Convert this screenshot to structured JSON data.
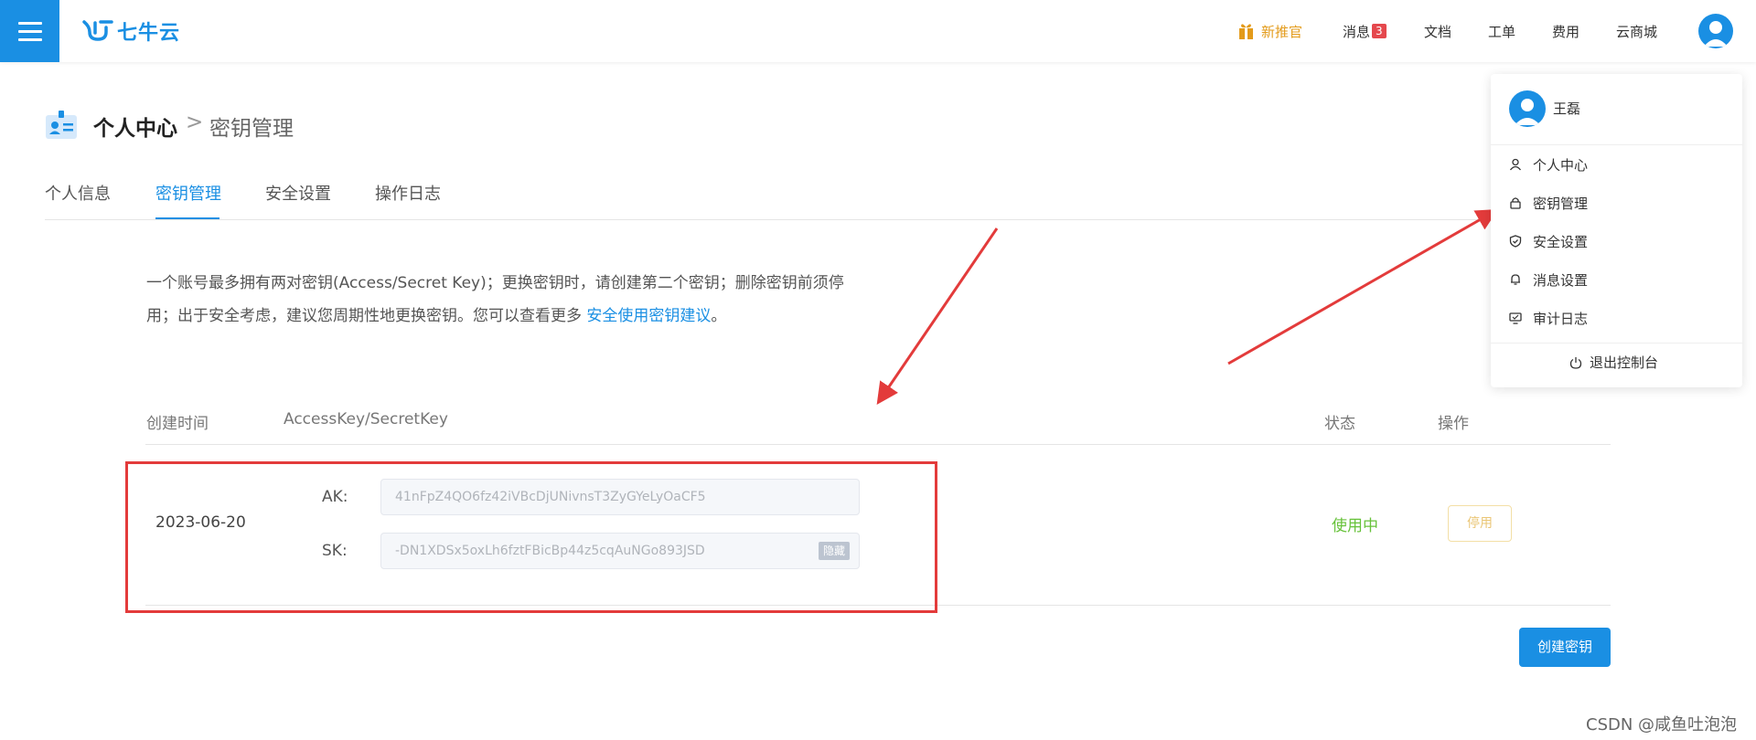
{
  "header": {
    "logo_text": "七牛云",
    "nav": {
      "new_promo": "新推官",
      "messages": "消息",
      "messages_count": "3",
      "docs": "文档",
      "tickets": "工单",
      "billing": "费用",
      "marketplace": "云商城"
    }
  },
  "page": {
    "title": "个人中心",
    "separator": ">",
    "subtitle": "密钥管理"
  },
  "tabs": [
    {
      "label": "个人信息"
    },
    {
      "label": "密钥管理"
    },
    {
      "label": "安全设置"
    },
    {
      "label": "操作日志"
    }
  ],
  "description": {
    "line1": "一个账号最多拥有两对密钥(Access/Secret Key)；更换密钥时，请创建第二个密钥；删除密钥前须停",
    "line2": "用；出于安全考虑，建议您周期性地更换密钥。您可以查看更多 ",
    "link": "安全使用密钥建议",
    "line2_end": "。"
  },
  "table": {
    "headers": {
      "created": "创建时间",
      "keys": "AccessKey/SecretKey",
      "status": "状态",
      "action": "操作"
    },
    "rows": [
      {
        "created": "2023-06-20",
        "ak_label": "AK:",
        "ak_value": "41nFpZ4QO6fz42iVBcDjUNivnsT3ZyGYeLyOaCF5",
        "sk_label": "SK:",
        "sk_value": "-DN1XDSx5oxLh6fztFBicBp44z5cqAuNGo893JSD",
        "hide_label": "隐藏",
        "status": "使用中",
        "disable_label": "停用"
      }
    ]
  },
  "create_button": "创建密钥",
  "dropdown": {
    "username": "王磊",
    "items": [
      {
        "label": "个人中心",
        "icon": "user-icon"
      },
      {
        "label": "密钥管理",
        "icon": "lock-icon"
      },
      {
        "label": "安全设置",
        "icon": "shield-check-icon"
      },
      {
        "label": "消息设置",
        "icon": "bell-icon"
      },
      {
        "label": "审计日志",
        "icon": "monitor-icon"
      }
    ],
    "logout": "退出控制台"
  },
  "watermark": "CSDN @咸鱼吐泡泡",
  "colors": {
    "primary": "#1a8fe3",
    "success": "#67c23a",
    "warning": "#eac676",
    "annotation": "#e33b3b",
    "promo": "#e39b1b"
  }
}
